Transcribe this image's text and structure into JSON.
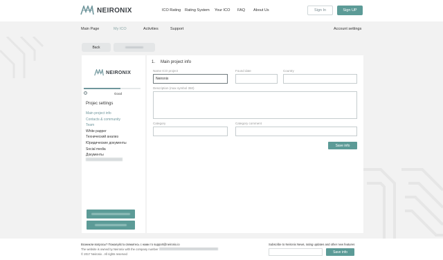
{
  "brand": {
    "name": "NEIRONIX"
  },
  "topnav": {
    "items": [
      {
        "label": "ICO Rating"
      },
      {
        "label": "Rating System"
      },
      {
        "label": "Your ICO"
      },
      {
        "label": "FAQ"
      },
      {
        "label": "About Us"
      }
    ],
    "sign_in": "Sign In",
    "sign_up": "Sign UP"
  },
  "subnav": {
    "items": [
      {
        "label": "Main Page"
      },
      {
        "label": "My ICO",
        "active": true
      },
      {
        "label": "Activities"
      },
      {
        "label": "Support"
      }
    ],
    "account": "Account settings"
  },
  "actions": {
    "back": "Back"
  },
  "sidebar": {
    "progress_fraction": 0.65,
    "status": "Good",
    "title": "Projec settings",
    "items": [
      {
        "label": "Main project info",
        "link": true
      },
      {
        "label": "Contacts & community",
        "link": true
      },
      {
        "label": "Team",
        "link": true
      },
      {
        "label": "White papper",
        "link": false
      },
      {
        "label": "Технический анализ",
        "link": false
      },
      {
        "label": "Юридические документы",
        "link": false
      },
      {
        "label": "Social media",
        "link": false
      },
      {
        "label": "Документы",
        "link": false
      }
    ]
  },
  "form": {
    "step_number": "1.",
    "step_title": "Main project info",
    "fields": {
      "ico_name": {
        "label": "Name ICO project",
        "value": "Neironix"
      },
      "found_date": {
        "label": "Found date",
        "value": ""
      },
      "country": {
        "label": "Country",
        "value": ""
      },
      "description": {
        "label": "Description (max symbol 350)",
        "value": ""
      },
      "category": {
        "label": "Category",
        "value": ""
      },
      "category_comment": {
        "label": "Category comment",
        "value": ""
      }
    },
    "save": "Save info"
  },
  "footer": {
    "contact": "Возникли вопросы? Пожалуйста свяжитесь с нами то support@neironix.io",
    "owned": "The website is owned by Neironix with the company number",
    "copyright": "© 2017 Neironix . All rights reserved",
    "subscribe_text": "Subscribe to Neironix News, rating updates and other new features",
    "subscribe_button": "Save info"
  },
  "colors": {
    "accent": "#5c9b97",
    "link": "#6f969c",
    "background": "#f2f2f2"
  }
}
